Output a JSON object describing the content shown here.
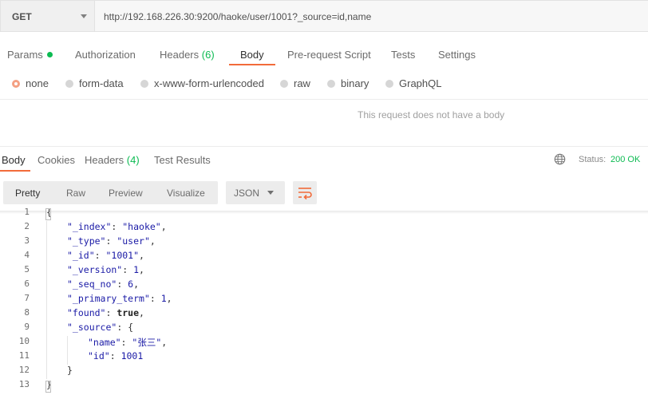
{
  "request": {
    "method": "GET",
    "url": "http://192.168.226.30:9200/haoke/user/1001?_source=id,name"
  },
  "request_tabs": {
    "params": "Params",
    "authorization": "Authorization",
    "headers": "Headers",
    "headers_count": "(6)",
    "body": "Body",
    "prerequest": "Pre-request Script",
    "tests": "Tests",
    "settings": "Settings",
    "active": "Body"
  },
  "body_types": {
    "none": "none",
    "form_data": "form-data",
    "urlencoded": "x-www-form-urlencoded",
    "raw": "raw",
    "binary": "binary",
    "graphql": "GraphQL",
    "selected": "none"
  },
  "no_body_message": "This request does not have a body",
  "response_tabs": {
    "body": "Body",
    "cookies": "Cookies",
    "headers": "Headers",
    "headers_count": "(4)",
    "test_results": "Test Results",
    "active": "Body"
  },
  "status": {
    "label": "Status:",
    "value": "200 OK"
  },
  "format_toolbar": {
    "pretty": "Pretty",
    "raw": "Raw",
    "preview": "Preview",
    "visualize": "Visualize",
    "language": "JSON",
    "active": "Pretty"
  },
  "colors": {
    "accent": "#f26b3a",
    "success": "#0cbb52"
  },
  "code_lines": [
    {
      "n": "1",
      "text": "{"
    },
    {
      "n": "2",
      "text": "\"_index\": \"haoke\","
    },
    {
      "n": "3",
      "text": "\"_type\": \"user\","
    },
    {
      "n": "4",
      "text": "\"_id\": \"1001\","
    },
    {
      "n": "5",
      "text": "\"_version\": 1,"
    },
    {
      "n": "6",
      "text": "\"_seq_no\": 6,"
    },
    {
      "n": "7",
      "text": "\"_primary_term\": 1,"
    },
    {
      "n": "8",
      "text": "\"found\": true,"
    },
    {
      "n": "9",
      "text": "\"_source\": {"
    },
    {
      "n": "10",
      "text": "\"name\": \"张三\","
    },
    {
      "n": "11",
      "text": "\"id\": 1001"
    },
    {
      "n": "12",
      "text": "}"
    },
    {
      "n": "13",
      "text": "}"
    }
  ]
}
